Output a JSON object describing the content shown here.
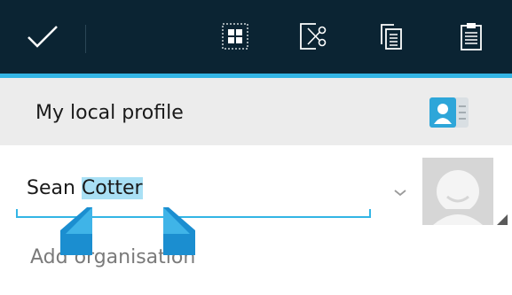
{
  "action_bar": {
    "done_icon": "checkmark-icon",
    "buttons": [
      {
        "name": "select-all",
        "icon": "select-all-icon"
      },
      {
        "name": "cut",
        "icon": "scissors-icon"
      },
      {
        "name": "copy",
        "icon": "copy-icon"
      },
      {
        "name": "paste",
        "icon": "clipboard-icon"
      }
    ],
    "background": "#0b2433",
    "accent": "#33b5e5"
  },
  "header": {
    "title": "My local profile",
    "icon": "contact-card-icon"
  },
  "name_field": {
    "first": "Sean ",
    "selected": "Cotter",
    "expand_icon": "chevron-down-icon"
  },
  "photo": {
    "icon": "contact-photo-placeholder"
  },
  "organisation": {
    "placeholder": "Add organisation"
  },
  "selection_color": "#a9e0f5"
}
